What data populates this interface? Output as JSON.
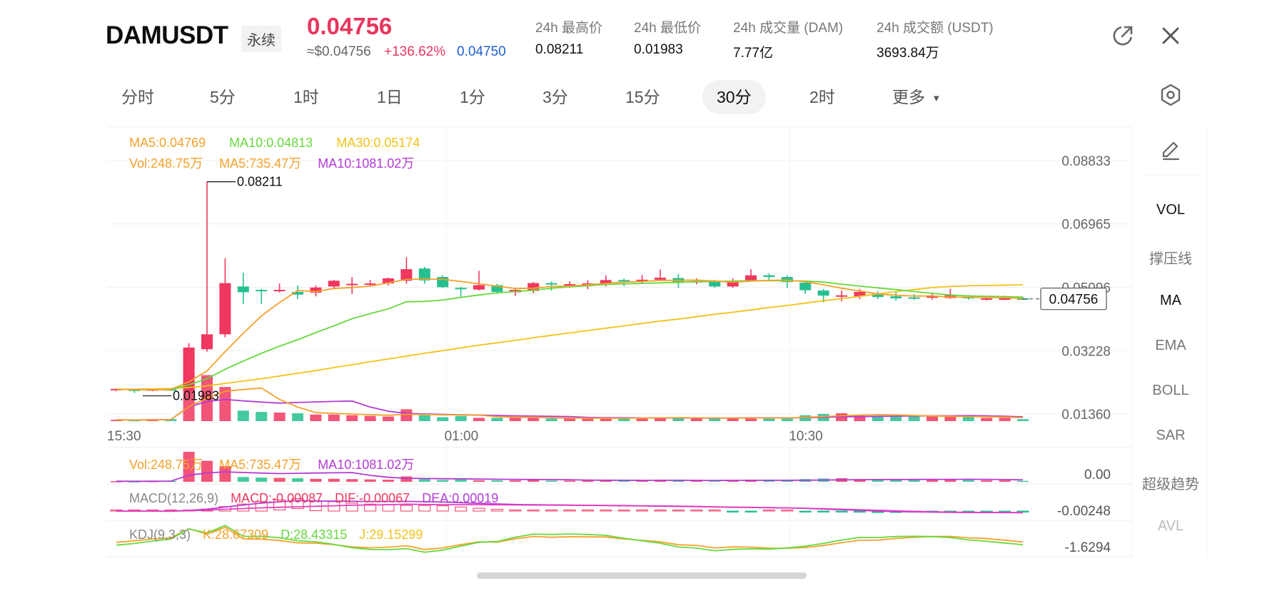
{
  "header": {
    "symbol": "DAMUSDT",
    "contract_tag": "永续",
    "last_price": "0.04756",
    "usd_price": "≈$0.04756",
    "change_pct": "+136.62%",
    "mark_price": "0.04750",
    "stats": [
      {
        "label": "24h 最高价",
        "value": "0.08211"
      },
      {
        "label": "24h 最低价",
        "value": "0.01983"
      },
      {
        "label": "24h 成交量 (DAM)",
        "value": "7.77亿"
      },
      {
        "label": "24h 成交额 (USDT)",
        "value": "3693.84万"
      }
    ],
    "icons": [
      "share-icon",
      "close-icon"
    ]
  },
  "intervals": {
    "items": [
      "分时",
      "5分",
      "1时",
      "1日",
      "1分",
      "3分",
      "15分",
      "30分",
      "2时",
      "更多"
    ],
    "active": "30分"
  },
  "legends": {
    "ma5": "MA5:0.04769",
    "ma10": "MA10:0.04813",
    "ma30": "MA30:0.05174",
    "vol": "Vol:248.75万",
    "vol_ma5": "MA5:735.47万",
    "vol_ma10": "MA10:1081.02万",
    "vol2": "Vol:248.75万",
    "vol2_ma5": "MA5:735.47万",
    "vol2_ma10": "MA10:1081.02万",
    "macd_title": "MACD(12,26,9)",
    "macd": "MACD:-0.00087",
    "dif": "DIF:-0.00067",
    "dea": "DEA:0.00019",
    "kdj_title": "KDJ(9,3,3)",
    "k": "K:28.67309",
    "d": "D:28.43315",
    "j": "J:29.15299"
  },
  "side_panel": {
    "items": [
      "VOL",
      "撑压线",
      "MA",
      "EMA",
      "BOLL",
      "SAR",
      "超级趋势",
      "AVL"
    ],
    "active": [
      "VOL",
      "MA"
    ],
    "disabled": [
      "AVL"
    ]
  },
  "colors": {
    "up": "#f0375f",
    "down": "#26bf91",
    "ma5": "#f4a12b",
    "ma10": "#67d83e",
    "ma30": "#f2c21b",
    "vol_ma10": "#b43ad6",
    "last_price": "#e8365d",
    "mark_price": "#1f5fcf"
  },
  "chart_data": {
    "type": "candlestick",
    "price_axis": [
      "0.08833",
      "0.06965",
      "0.05096",
      "0.03228",
      "0.01360"
    ],
    "price_range": [
      0.0136,
      0.08833
    ],
    "time_labels": [
      {
        "label": "15:30",
        "candle": 0
      },
      {
        "label": "01:00",
        "candle": 19
      },
      {
        "label": "10:30",
        "candle": 38
      }
    ],
    "high_marker": "0.08211",
    "low_marker": "0.01983",
    "current_price_label": "0.04756",
    "current_price": 0.04756,
    "sub_axis": {
      "vol": "0.00",
      "macd": "-0.00248",
      "kdj": "-1.6294"
    },
    "candles": [
      [
        0.0208,
        0.021,
        0.0211,
        0.0203
      ],
      [
        0.0208,
        0.0206,
        0.021,
        0.0198
      ],
      [
        0.0207,
        0.0209,
        0.0211,
        0.0203
      ],
      [
        0.0209,
        0.0208,
        0.0211,
        0.0205
      ],
      [
        0.0203,
        0.0332,
        0.0345,
        0.0202
      ],
      [
        0.0327,
        0.0371,
        0.0821,
        0.032
      ],
      [
        0.0371,
        0.0522,
        0.0595,
        0.0362
      ],
      [
        0.0512,
        0.0495,
        0.0553,
        0.046
      ],
      [
        0.0502,
        0.05,
        0.0505,
        0.046
      ],
      [
        0.05,
        0.0502,
        0.0521,
        0.0494
      ],
      [
        0.0496,
        0.0488,
        0.0515,
        0.0475
      ],
      [
        0.0494,
        0.0509,
        0.0515,
        0.0483
      ],
      [
        0.0512,
        0.0529,
        0.0531,
        0.0504
      ],
      [
        0.0518,
        0.052,
        0.054,
        0.049
      ],
      [
        0.052,
        0.0521,
        0.0531,
        0.0514
      ],
      [
        0.0521,
        0.0536,
        0.0538,
        0.0515
      ],
      [
        0.0529,
        0.0563,
        0.0598,
        0.052
      ],
      [
        0.0565,
        0.053,
        0.057,
        0.052
      ],
      [
        0.054,
        0.051,
        0.0545,
        0.0508
      ],
      [
        0.0508,
        0.0505,
        0.0511,
        0.0482
      ],
      [
        0.0503,
        0.0516,
        0.0558,
        0.05
      ],
      [
        0.0516,
        0.0496,
        0.052,
        0.049
      ],
      [
        0.0495,
        0.0502,
        0.0508,
        0.0484
      ],
      [
        0.0499,
        0.0522,
        0.0525,
        0.0492
      ],
      [
        0.0522,
        0.052,
        0.0527,
        0.05
      ],
      [
        0.0519,
        0.0519,
        0.0527,
        0.0508
      ],
      [
        0.052,
        0.0521,
        0.053,
        0.0504
      ],
      [
        0.052,
        0.0531,
        0.0545,
        0.0512
      ],
      [
        0.0531,
        0.053,
        0.0535,
        0.0513
      ],
      [
        0.053,
        0.0532,
        0.0546,
        0.0522
      ],
      [
        0.0532,
        0.0538,
        0.0562,
        0.053
      ],
      [
        0.0537,
        0.0525,
        0.0549,
        0.0508
      ],
      [
        0.0525,
        0.0528,
        0.0536,
        0.0518
      ],
      [
        0.0528,
        0.0512,
        0.0532,
        0.0508
      ],
      [
        0.0512,
        0.0526,
        0.0536,
        0.0508
      ],
      [
        0.0529,
        0.0545,
        0.0563,
        0.0529
      ],
      [
        0.0545,
        0.054,
        0.055,
        0.0527
      ],
      [
        0.054,
        0.0525,
        0.0545,
        0.0508
      ],
      [
        0.0523,
        0.0501,
        0.0525,
        0.049
      ],
      [
        0.05,
        0.0485,
        0.0505,
        0.0465
      ],
      [
        0.0485,
        0.0486,
        0.05,
        0.0468
      ],
      [
        0.0483,
        0.0496,
        0.0505,
        0.0475
      ],
      [
        0.0492,
        0.0481,
        0.0498,
        0.0475
      ],
      [
        0.0483,
        0.0477,
        0.0496,
        0.047
      ],
      [
        0.048,
        0.0479,
        0.049,
        0.0472
      ],
      [
        0.0479,
        0.0483,
        0.0494,
        0.0473
      ],
      [
        0.0478,
        0.0486,
        0.0505,
        0.0476
      ],
      [
        0.0481,
        0.0477,
        0.0487,
        0.0473
      ],
      [
        0.0476,
        0.0477,
        0.0484,
        0.0471
      ],
      [
        0.0476,
        0.0477,
        0.0485,
        0.0472
      ],
      [
        0.0477,
        0.0476,
        0.0481,
        0.0472
      ]
    ],
    "volume": [
      0.2,
      0.15,
      0.25,
      0.3,
      10.0,
      7.0,
      5.2,
      1.6,
      1.4,
      1.3,
      1.2,
      1.0,
      1.0,
      0.9,
      0.8,
      0.7,
      1.8,
      0.9,
      0.6,
      0.8,
      0.5,
      0.5,
      0.5,
      0.6,
      0.4,
      0.4,
      0.4,
      0.5,
      0.5,
      0.5,
      0.6,
      0.5,
      0.4,
      0.4,
      0.5,
      0.6,
      0.5,
      0.4,
      0.9,
      1.1,
      1.2,
      0.9,
      0.8,
      0.7,
      0.7,
      0.8,
      0.7,
      0.6,
      0.5,
      0.5,
      0.3
    ],
    "ma5": [
      0.0209,
      0.0208,
      0.0208,
      0.0208,
      0.0231,
      0.0263,
      0.032,
      0.0374,
      0.0425,
      0.0465,
      0.05,
      0.0497,
      0.0506,
      0.0509,
      0.0513,
      0.0523,
      0.0533,
      0.0534,
      0.0533,
      0.0527,
      0.052,
      0.0513,
      0.0506,
      0.0507,
      0.0512,
      0.0513,
      0.0517,
      0.0521,
      0.0525,
      0.0527,
      0.053,
      0.053,
      0.0531,
      0.0528,
      0.0525,
      0.0528,
      0.053,
      0.0531,
      0.0526,
      0.0517,
      0.0507,
      0.0499,
      0.049,
      0.0486,
      0.0484,
      0.0484,
      0.0481,
      0.048,
      0.048,
      0.0479,
      0.0477
    ],
    "ma10": [
      0.0209,
      0.0208,
      0.0208,
      0.0208,
      0.0222,
      0.024,
      0.0268,
      0.0292,
      0.0315,
      0.0336,
      0.0355,
      0.0376,
      0.0396,
      0.0417,
      0.0432,
      0.0446,
      0.0467,
      0.0468,
      0.0472,
      0.048,
      0.0487,
      0.0493,
      0.0497,
      0.0501,
      0.0507,
      0.0511,
      0.0514,
      0.0518,
      0.052,
      0.0521,
      0.0523,
      0.0524,
      0.0526,
      0.0527,
      0.0528,
      0.0529,
      0.0529,
      0.0529,
      0.0528,
      0.0525,
      0.0519,
      0.0513,
      0.0508,
      0.0503,
      0.0497,
      0.0492,
      0.0487,
      0.0484,
      0.0483,
      0.0482,
      0.0481
    ],
    "ma30": [
      0.0209,
      0.0209,
      0.021,
      0.0211,
      0.0214,
      0.0219,
      0.0226,
      0.0233,
      0.024,
      0.0248,
      0.0256,
      0.0264,
      0.0273,
      0.0281,
      0.029,
      0.0298,
      0.0307,
      0.0315,
      0.0323,
      0.0331,
      0.0339,
      0.0346,
      0.0353,
      0.0361,
      0.0368,
      0.0375,
      0.0382,
      0.0389,
      0.0396,
      0.0403,
      0.041,
      0.0416,
      0.0423,
      0.043,
      0.0436,
      0.0443,
      0.045,
      0.0456,
      0.0463,
      0.047,
      0.0476,
      0.0483,
      0.049,
      0.0497,
      0.0503,
      0.0509,
      0.0512,
      0.0514,
      0.0515,
      0.0516,
      0.0517
    ]
  }
}
